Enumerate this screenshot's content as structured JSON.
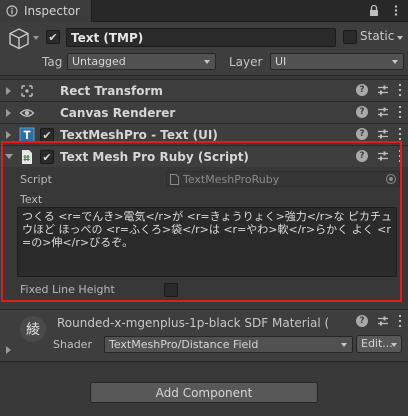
{
  "tab": {
    "label": "Inspector"
  },
  "object": {
    "name": "Text (TMP)",
    "active": true,
    "static_label": "Static",
    "tag_label": "Tag",
    "tag_value": "Untagged",
    "layer_label": "Layer",
    "layer_value": "UI"
  },
  "components": [
    {
      "title": "Rect Transform",
      "icon": "rect-transform-icon",
      "expanded": false
    },
    {
      "title": "Canvas Renderer",
      "icon": "eye-icon",
      "expanded": false
    },
    {
      "title": "TextMeshPro - Text (UI)",
      "icon": "textmeshpro-icon",
      "expanded": false,
      "enabled": true
    },
    {
      "title": "Text Mesh Pro Ruby (Script)",
      "icon": "csharp-script-icon",
      "expanded": true,
      "enabled": true
    }
  ],
  "ruby": {
    "script_label": "Script",
    "script_value": "TextMeshProRuby",
    "text_label": "Text",
    "text_value": "つくる <r=でんき>電気</r>が <r=きょうりょく>強力</r>な ピカチュウほど ほっぺの <r=ふくろ>袋</r>は <r=やわ>軟</r>らかく よく <r=の>伸</r>びるぞ。",
    "fixed_line_height_label": "Fixed Line Height",
    "fixed_line_height": false
  },
  "material": {
    "name": "Rounded-x-mgenplus-1p-black SDF Material (",
    "shader_label": "Shader",
    "shader_value": "TextMeshPro/Distance Field",
    "edit_label": "Edit..."
  },
  "add_component_label": "Add Component",
  "colors": {
    "panel_bg": "#383838",
    "highlight": "#e8191a",
    "text": "#c4c4c4"
  }
}
